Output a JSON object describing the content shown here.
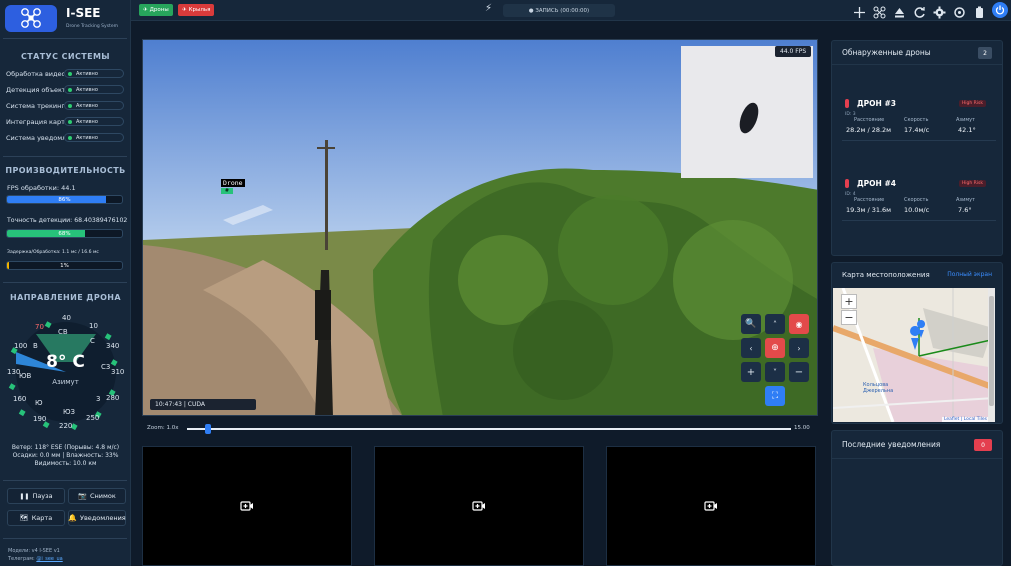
{
  "app": {
    "title": "I-SEE",
    "subtitle": "Drone Tracking System"
  },
  "sidebar": {
    "status_title": "СТАТУС СИСТЕМЫ",
    "status_items": [
      {
        "label": "Обработка видео",
        "value": "Активно"
      },
      {
        "label": "Детекция объектов",
        "value": "Активно"
      },
      {
        "label": "Система трекинга",
        "value": "Активно"
      },
      {
        "label": "Интеграция карты",
        "value": "Активно"
      },
      {
        "label": "Система уведомлений",
        "value": "Активно"
      }
    ],
    "perf_title": "ПРОИЗВОДИТЕЛЬНОСТЬ",
    "perf": [
      {
        "label": "FPS обработки: 44.1",
        "bar_text": "86%",
        "level": 0.86,
        "color": "#2f7ef5"
      },
      {
        "label": "Точность детекции: 68.40389476102",
        "bar_text": "68%",
        "level": 0.68,
        "color": "#27c27a"
      },
      {
        "label": "Задержка/Обработка: 1.1 мс / 16.6 мс",
        "bar_text": "1%",
        "level": 0.01,
        "color": "#f0b400"
      }
    ],
    "direction_title": "НАПРАВЛЕНИЕ ДРОНА",
    "compass": {
      "temperature": "8° C",
      "azimuth_label": "Азимут",
      "labels": [
        "40",
        "СВ",
        "10",
        "С",
        "340",
        "С3",
        "310",
        "280",
        "3",
        "250",
        "ЮЗ",
        "220",
        "190",
        "Ю",
        "160",
        "130",
        "ЮВ",
        "100",
        "В",
        "70"
      ]
    },
    "weather_line1": "Ветер: 118° ESE (Порывы: 4.8 м/с)",
    "weather_line2": "Осадки: 0.0 мм | Влажность: 33%",
    "weather_line3": "Видимость: 10.0 км",
    "buttons": {
      "pause": "Пауза",
      "snapshot": "Снимок",
      "map": "Карта",
      "notifications": "Уведомления"
    },
    "footer_models": "Модели: v4 I-SEE v1",
    "footer_telegram_label": "Телеграм:",
    "footer_telegram_link": "@i_see_ua"
  },
  "topbar": {
    "drones_tag": "Дроны",
    "wings_tag": "Крылья",
    "record": "● ЗАПИСЬ (00:00:00)"
  },
  "video": {
    "fps_badge": "44.0 FPS",
    "detection_label": "Drone",
    "detection_id": "#",
    "timestamp": "10:47:43 | CUDA",
    "zoom_label": "Zoom: 1.0x",
    "zoom_end": "15.00",
    "zoom_level": 0.03
  },
  "drones_panel": {
    "title": "Обнаруженные дроны",
    "count": "2",
    "drones": [
      {
        "name": "ДРОН #3",
        "risk": "High Risk",
        "id": "ID: 3",
        "distance_label": "Расстояние",
        "distance": "28.2м / 28.2м",
        "speed_label": "Скорость",
        "speed": "17.4м/с",
        "azimuth_label": "Азимут",
        "azimuth": "42.1°"
      },
      {
        "name": "ДРОН #4",
        "risk": "High Risk",
        "id": "ID: 4",
        "distance_label": "Расстояние",
        "distance": "19.3м / 31.6м",
        "speed_label": "Скорость",
        "speed": "10.0м/с",
        "azimuth_label": "Азимут",
        "azimuth": "7.6°"
      }
    ]
  },
  "map_panel": {
    "title": "Карта местоположения",
    "fullscreen": "Полный экран",
    "place": "Кольцова Джерельна",
    "attribution": "Leaflet | Local Tiles"
  },
  "notif_panel": {
    "title": "Последние уведомления",
    "count": "0"
  },
  "colors": {
    "accent": "#2f7ef5",
    "danger": "#e43f4f",
    "success": "#27c27a"
  }
}
